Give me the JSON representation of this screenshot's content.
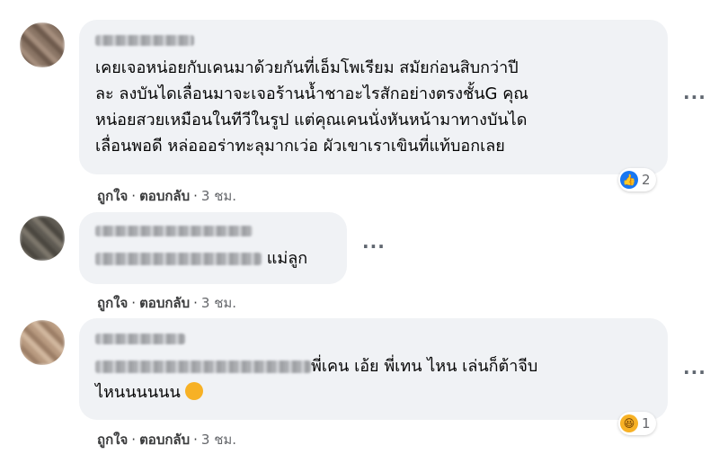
{
  "comments": [
    {
      "text": "เคยเจอหน่อยกับเคนมาด้วยกันที่เอ็มโพเรียม สมัยก่อนสิบกว่าปี ละ ลงบันไดเลื่อนมาจะเจอร้านน้ำชาอะไรสักอย่างตรงชั้นG คุณหน่อยสวยเหมือนในทีวีในรูป แต่คุณเคนนั่งหันหน้ามาทางบันไดเลื่อนพอดี หล่อออร่าทะลุมากเว่อ ผัวเขาเราเขินที่แท้บอกเลย",
      "like_label": "ถูกใจ",
      "reply_label": "ตอบกลับ",
      "time": "3 ชม.",
      "reaction_count": "2"
    },
    {
      "text": "แม่ลูก",
      "like_label": "ถูกใจ",
      "reply_label": "ตอบกลับ",
      "time": "3 ชม."
    },
    {
      "text": "พี่เคน เอ้ย พี่เทน ไหน เล่นก็ต้าจีบ ไหนนนนนน",
      "like_label": "ถูกใจ",
      "reply_label": "ตอบกลับ",
      "time": "3 ชม.",
      "reaction_count": "1"
    }
  ],
  "more_label": "···",
  "separator": "·",
  "icons": {
    "like": "thumbs-up-icon",
    "haha": "laughing-face-icon",
    "more": "more-options-icon"
  },
  "colors": {
    "bubble": "#f0f2f5",
    "like_blue": "#1877f2",
    "haha_yellow": "#f7b125"
  }
}
